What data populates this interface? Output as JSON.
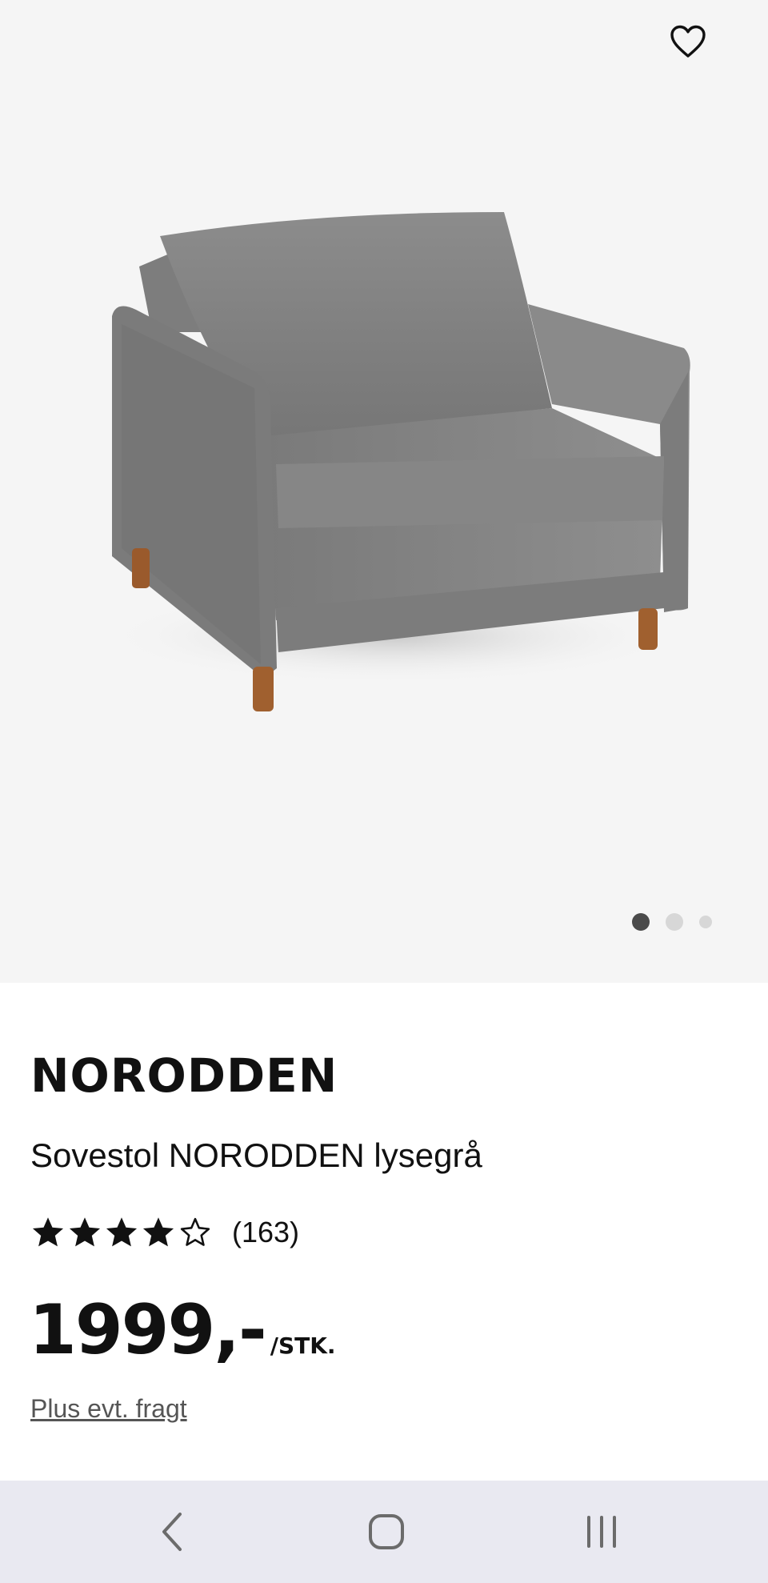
{
  "product": {
    "brand": "NORODDEN",
    "title": "Sovestol NORODDEN lysegrå",
    "rating": 4,
    "rating_max": 5,
    "review_count": "(163)",
    "price": "1999,-",
    "unit": "/STK.",
    "freight_note": "Plus evt. fragt"
  },
  "gallery": {
    "image_count": 3,
    "current_index": 1,
    "image_name": "grey-armchair-sofa-bed-photo"
  },
  "icons": {
    "favorite": "heart-outline-icon",
    "back": "chevron-left-icon",
    "home": "rounded-square-icon",
    "recents": "three-bars-icon"
  },
  "colors": {
    "hero_bg": "#f5f5f5",
    "text": "#111111",
    "active_dot": "#4a4a4a",
    "inactive_dot": "#d7d7d7",
    "nav_bg": "#e9e9f1"
  }
}
